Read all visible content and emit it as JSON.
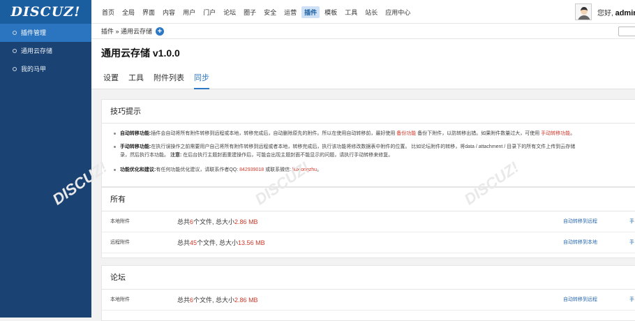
{
  "logo": "DISCUZ!",
  "nav": [
    "首页",
    "全局",
    "界面",
    "内容",
    "用户",
    "门户",
    "论坛",
    "圈子",
    "安全",
    "运营",
    "插件",
    "模板",
    "工具",
    "站长",
    "应用中心"
  ],
  "nav_active_index": 10,
  "user": {
    "greeting": "您好,",
    "name": "admin"
  },
  "sidebar": [
    {
      "label": "插件管理",
      "active": true
    },
    {
      "label": "通用云存储",
      "active": false
    },
    {
      "label": "我的马甲",
      "active": false
    }
  ],
  "breadcrumb": "插件 » 通用云存储",
  "page_title": "通用云存储 v1.0.0",
  "tabs": [
    {
      "label": "设置",
      "active": false
    },
    {
      "label": "工具",
      "active": false
    },
    {
      "label": "附件列表",
      "active": false
    },
    {
      "label": "同步",
      "active": true
    }
  ],
  "tips": {
    "heading": "技巧提示",
    "line1": {
      "bold": "自动转移功能:",
      "text": "插件会自动将所有附件转移到远程或本地，转移完成后，自动删除原先的附件。所以在使用自动转移前，最好使用",
      "link1": "备份功能",
      "text2": "备份下附件，以防转移出错。如果附件数量过大，可使用",
      "link2": "手动转移功能",
      "text3": "。"
    },
    "line2": {
      "bold": "手动转移功能:",
      "text": "在执行误操作之前需要用户自己将所有附件转移到远程或者本地，转移完成后，执行该功能将修改数据表中附件的位置。 比如论坛附件的转移，将data / attachment / 目录下的所有文件上传到云存储",
      "cont": "录，然后执行本功能。",
      "note_bold": "注意:",
      "note": "在后台执行主题封面重建操作后，可能会出现主题封面不能显示的问题，请执行手动转移来修复。"
    },
    "line3": {
      "bold": "功能优化和建议:",
      "text": "有任何功能优化建议，请联系作者QQ:",
      "qq": "842939018",
      "text2": "或联系微信:",
      "wx": "liuxiongzhu",
      "text3": "。"
    }
  },
  "sections": [
    {
      "title": "所有",
      "rows": [
        {
          "label": "本地附件",
          "pre": "总共",
          "count": "6",
          "mid": "个文件, 总大小",
          "size": "2.86 MB",
          "action": "自动转移到远程",
          "action2": "手"
        },
        {
          "label": "远程附件",
          "pre": "总共",
          "count": "45",
          "mid": "个文件, 总大小",
          "size": "13.56 MB",
          "action": "自动转移到本地",
          "action2": "手"
        }
      ]
    },
    {
      "title": "论坛",
      "rows": [
        {
          "label": "本地附件",
          "pre": "总共",
          "count": "6",
          "mid": "个文件, 总大小",
          "size": "2.86 MB",
          "action": "自动转移到远程",
          "action2": "手"
        }
      ]
    }
  ]
}
